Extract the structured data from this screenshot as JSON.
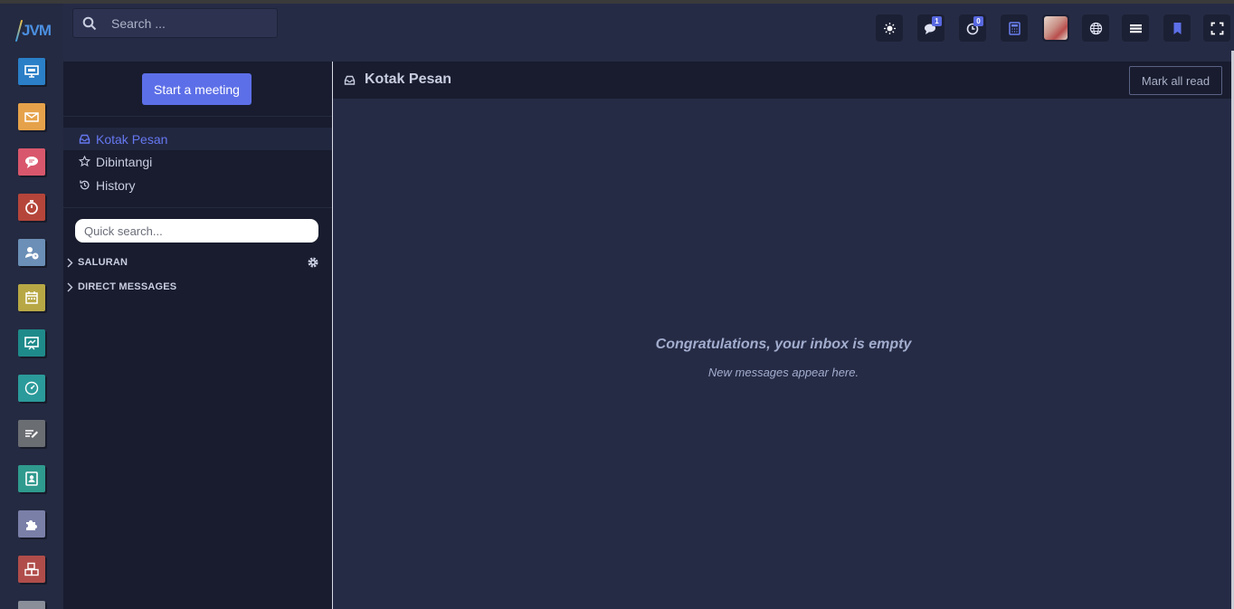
{
  "brand": {
    "logo_text": "JVM"
  },
  "topbar": {
    "search_placeholder": "Search ...",
    "chat_badge": "1",
    "activity_badge": "0"
  },
  "sidebar": {
    "start_meeting_label": "Start a meeting",
    "nav": [
      {
        "label": "Kotak Pesan",
        "icon": "inbox-icon",
        "active": true
      },
      {
        "label": "Dibintangi",
        "icon": "star-icon",
        "active": false
      },
      {
        "label": "History",
        "icon": "history-icon",
        "active": false
      }
    ],
    "quick_search_placeholder": "Quick search...",
    "groups": [
      {
        "label": "SALURAN"
      },
      {
        "label": "DIRECT MESSAGES"
      }
    ]
  },
  "main": {
    "title": "Kotak Pesan",
    "mark_all_read_label": "Mark all read",
    "empty_title": "Congratulations, your inbox is empty",
    "empty_subtitle": "New messages appear here."
  },
  "apps": [
    {
      "name": "app-discuss",
      "color": "#2a7fc7"
    },
    {
      "name": "app-email-marketing",
      "color": "#e6a24a"
    },
    {
      "name": "app-live-chat",
      "color": "#d9576c"
    },
    {
      "name": "app-timesheets",
      "color": "#b5453a"
    },
    {
      "name": "app-attendance",
      "color": "#6b8fb6"
    },
    {
      "name": "app-calendar",
      "color": "#b8a845"
    },
    {
      "name": "app-elearning",
      "color": "#1f8a8a"
    },
    {
      "name": "app-dashboard",
      "color": "#2b9a9a"
    },
    {
      "name": "app-notes",
      "color": "#6a6d72"
    },
    {
      "name": "app-contacts",
      "color": "#2f9a8e"
    },
    {
      "name": "app-apps",
      "color": "#7a7fa8"
    },
    {
      "name": "app-inventory",
      "color": "#b04d4a"
    }
  ]
}
